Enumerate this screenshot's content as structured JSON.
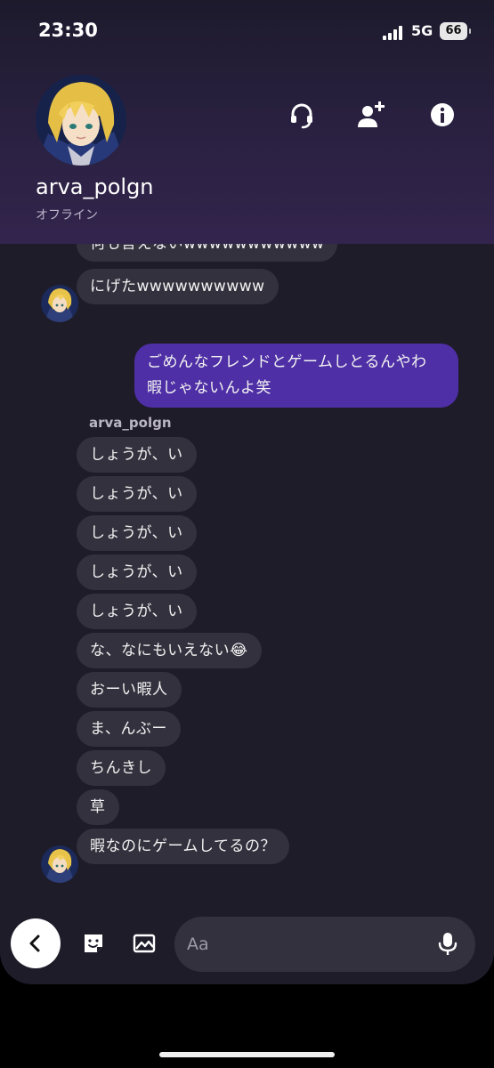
{
  "status_bar": {
    "time": "23:30",
    "network": "5G",
    "battery": "66"
  },
  "header": {
    "username": "arva_polgn",
    "presence": "オフライン",
    "icons": [
      "headset-icon",
      "add-friend-icon",
      "info-icon"
    ]
  },
  "messages": {
    "partial_top": "何も言えないwwwwwwwwwww",
    "m1": "にげたwwwwwwwwww",
    "me1_line1": "ごめんなフレンドとゲームしとるんやわ",
    "me1_line2": "暇じゃないんよ笑",
    "sender_name": "arva_polgn",
    "group": [
      "しょうが、い",
      "しょうが、い",
      "しょうが、い",
      "しょうが、い",
      "しょうが、い",
      "な、なにもいえない😂",
      "おーい暇人",
      "ま、んぶー",
      "ちんきし",
      "草",
      "暇なのにゲームしてるの？"
    ]
  },
  "composer": {
    "placeholder": "Aa",
    "icons": [
      "back-icon",
      "sticker-icon",
      "image-icon",
      "microphone-icon"
    ]
  },
  "colors": {
    "background": "#1e1c29",
    "my_bubble": "#4e2fa5",
    "their_bubble": "#33313d",
    "header_gradient_end": "#33244d"
  }
}
